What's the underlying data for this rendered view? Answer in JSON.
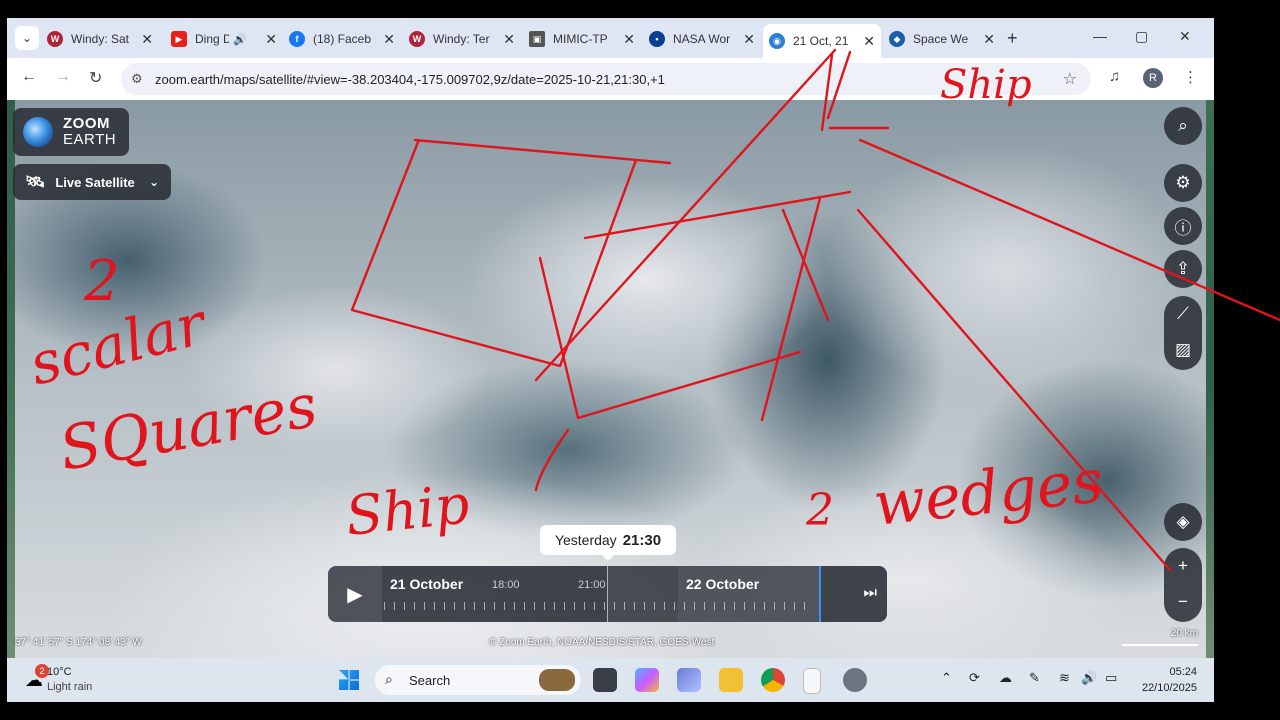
{
  "browser": {
    "tabs": [
      {
        "title": "Windy: Sat",
        "icon": "windy-icon",
        "color": "#b0243a"
      },
      {
        "title": "Ding D",
        "icon": "youtube-icon",
        "color": "#e62117"
      },
      {
        "title": "(18) Faceb",
        "icon": "facebook-icon",
        "color": "#1877f2"
      },
      {
        "title": "Windy: Ter",
        "icon": "windy-icon",
        "color": "#b0243a"
      },
      {
        "title": "MIMIC-TP",
        "icon": "mimic-icon",
        "color": "#555555"
      },
      {
        "title": "NASA Wor",
        "icon": "nasa-icon",
        "color": "#0b3d91"
      },
      {
        "title": "21 Oct, 21",
        "icon": "zoom-earth-icon",
        "color": "#2a7fd8",
        "active": true
      },
      {
        "title": "Space We",
        "icon": "noaa-icon",
        "color": "#1c5ea8"
      }
    ],
    "url": "zoom.earth/maps/satellite/#view=-38.203404,-175.009702,9z/date=2025-10-21,21:30,+1",
    "profile_initial": "R"
  },
  "map": {
    "brand_line1": "ZOOM",
    "brand_line2": "EARTH",
    "layer_label": "Live Satellite",
    "tooltip_day": "Yesterday",
    "tooltip_time": "21:30",
    "timeline": {
      "day1": "21 October",
      "hour_a": "18:00",
      "hour_b": "21:00",
      "day2": "22 October"
    },
    "coords": "37° 41′ 57″ S   174° 08′ 43″ W",
    "attribution": "© Zoom Earth, NOAA/NESDIS/STAR, GOES-West",
    "scale_label": "20 km"
  },
  "annotations": {
    "top_word": "Ship",
    "left_number": "2",
    "left_word1": "scalar",
    "left_word2": "SQuares",
    "mid_word": "Ship",
    "right_number": "2",
    "right_word": "wedges",
    "ink_color": "#e0141c"
  },
  "taskbar": {
    "temperature": "10°C",
    "condition": "Light rain",
    "badge": "2",
    "search_placeholder": "Search",
    "time": "05:24",
    "date": "22/10/2025"
  }
}
